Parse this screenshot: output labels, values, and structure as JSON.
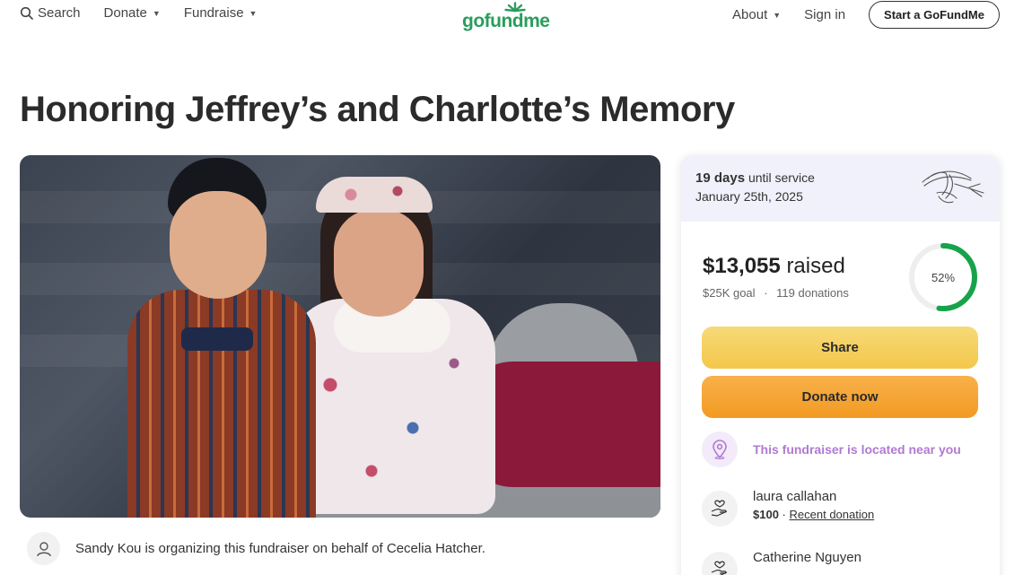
{
  "header": {
    "search_label": "Search",
    "donate_label": "Donate",
    "fundraise_label": "Fundraise",
    "logo_text": "gofundme",
    "about_label": "About",
    "signin_label": "Sign in",
    "start_label": "Start a GoFundMe"
  },
  "title": "Honoring Jeffrey’s and Charlotte’s Memory",
  "organizer": {
    "text": "Sandy Kou is organizing this fundraiser on behalf of Cecelia Hatcher."
  },
  "card": {
    "days": "19 days",
    "until_text": "until service",
    "service_date": "January 25th, 2025",
    "raised_amount": "$13,055",
    "raised_suffix": "raised",
    "goal": "$25K goal",
    "separator": "·",
    "donations_count": "119 donations",
    "progress_percent": 52,
    "progress_label": "52%",
    "share_label": "Share",
    "donate_label": "Donate now",
    "location_text": "This fundraiser is located near you",
    "donations": [
      {
        "name": "laura callahan",
        "amount": "$100",
        "sep": "·",
        "tag": "Recent donation"
      },
      {
        "name": "Catherine Nguyen",
        "amount": "",
        "sep": "",
        "tag": ""
      }
    ]
  },
  "colors": {
    "brand_green": "#2a9d5c",
    "progress_green": "#16a34a",
    "share_yellow": "#f3c74a",
    "donate_orange": "#f29a22",
    "location_purple": "#b07ad1"
  },
  "icons": {
    "search": "search-icon",
    "caret": "chevron-down-icon",
    "lily": "lily-flower-icon",
    "pin": "map-pin-icon",
    "donor": "hand-heart-icon",
    "person": "user-icon"
  }
}
